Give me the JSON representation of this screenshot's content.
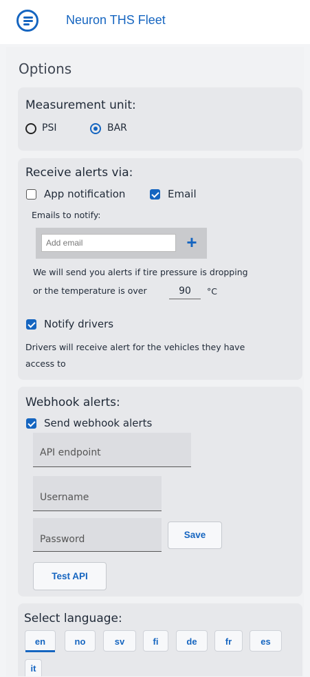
{
  "app": {
    "title": "Neuron THS Fleet"
  },
  "page": {
    "title": "Options"
  },
  "measurement": {
    "title": "Measurement unit:",
    "options": [
      {
        "label": "PSI",
        "selected": false
      },
      {
        "label": "BAR",
        "selected": true
      }
    ]
  },
  "alerts": {
    "title": "Receive alerts via:",
    "app_notification": {
      "label": "App notification",
      "checked": false
    },
    "email": {
      "label": "Email",
      "checked": true
    },
    "emails_label": "Emails to notify:",
    "email_placeholder": "Add email",
    "add_button": "+",
    "info_line1": "We will send you alerts if tire pressure is dropping",
    "info_line2": "or the temperature is over",
    "temperature": "90",
    "temperature_unit": "°C",
    "notify_drivers": {
      "label": "Notify drivers",
      "checked": true
    },
    "drivers_info_line1": "Drivers will receive alert for the vehicles they have",
    "drivers_info_line2": "access to"
  },
  "webhook": {
    "title": "Webhook alerts:",
    "send": {
      "label": "Send webhook alerts",
      "checked": true
    },
    "api_endpoint_placeholder": "API endpoint",
    "username_placeholder": "Username",
    "password_placeholder": "Password",
    "save_label": "Save",
    "test_label": "Test API"
  },
  "language": {
    "title": "Select language:",
    "options": [
      "en",
      "no",
      "sv",
      "fi",
      "de",
      "fr",
      "es",
      "it"
    ],
    "selected": "en"
  },
  "colors": {
    "accent": "#1565c0",
    "card": "#e7e8eb",
    "background": "#f3f4f6"
  }
}
